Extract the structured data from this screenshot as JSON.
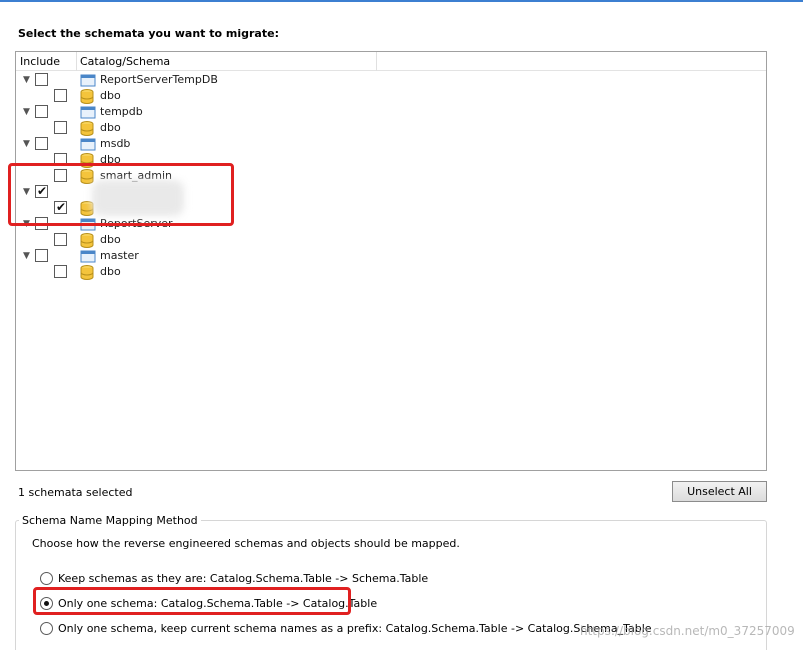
{
  "heading": "Select the schemata you want to migrate:",
  "tree": {
    "columns": {
      "include": "Include",
      "catalog": "Catalog/Schema"
    },
    "items": [
      {
        "label": "ReportServerTempDB",
        "checked": false
      },
      {
        "label": "dbo",
        "checked": false
      },
      {
        "label": "tempdb",
        "checked": false
      },
      {
        "label": "dbo",
        "checked": false
      },
      {
        "label": "msdb",
        "checked": false
      },
      {
        "label": "dbo",
        "checked": false
      },
      {
        "label": "smart_admin",
        "checked": false
      },
      {
        "label": "",
        "checked": true
      },
      {
        "label": "",
        "checked": true
      },
      {
        "label": "ReportServer",
        "checked": false
      },
      {
        "label": "dbo",
        "checked": false
      },
      {
        "label": "master",
        "checked": false
      },
      {
        "label": "dbo",
        "checked": false
      }
    ]
  },
  "status": "1 schemata selected",
  "unselect_all_label": "Unselect All",
  "mapping": {
    "legend": "Schema Name Mapping Method",
    "description": "Choose how the reverse engineered schemas and objects should be mapped.",
    "options": [
      {
        "label": "Keep schemas as they are: Catalog.Schema.Table -> Schema.Table",
        "selected": false
      },
      {
        "label": "Only one schema: Catalog.Schema.Table -> Catalog.Table",
        "selected": true
      },
      {
        "label": "Only one schema, keep current schema names as a prefix: Catalog.Schema.Table -> Catalog.Schema_Table",
        "selected": false
      }
    ]
  },
  "watermark": "https://blog.csdn.net/m0_37257009",
  "colors": {
    "highlight": "#e02020",
    "accent": "#3c7fd1"
  }
}
